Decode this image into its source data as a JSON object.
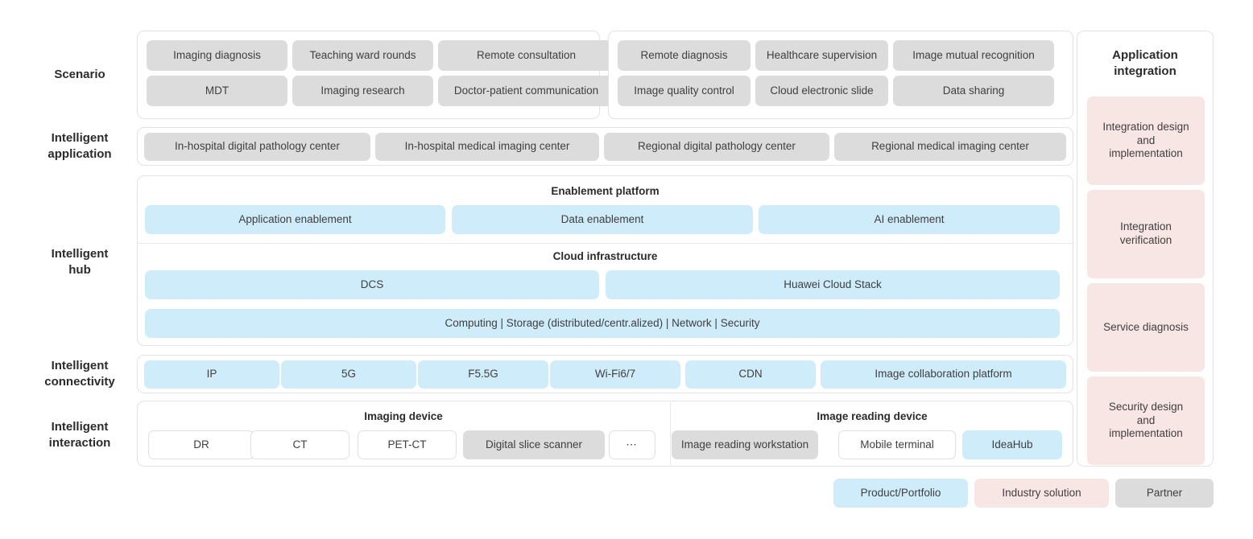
{
  "rows": [
    {
      "label": "Scenario"
    },
    {
      "label": "Intelligent\napplication"
    },
    {
      "label": "Intelligent\nhub"
    },
    {
      "label": "Intelligent\nconnectivity"
    },
    {
      "label": "Intelligent\ninteraction"
    }
  ],
  "scenario": {
    "group_left": [
      "Imaging diagnosis",
      "Teaching ward rounds",
      "Remote consultation",
      "MDT",
      "Imaging research",
      "Doctor-patient communication"
    ],
    "group_right": [
      "Remote diagnosis",
      "Healthcare supervision",
      "Image mutual recognition",
      "Image quality control",
      "Cloud electronic slide",
      "Data sharing"
    ]
  },
  "intelligent_application": {
    "items": [
      "In-hospital digital pathology center",
      "In-hospital medical imaging center",
      "Regional digital pathology center",
      "Regional medical imaging center"
    ]
  },
  "intelligent_hub": {
    "enablement_platform": {
      "title": "Enablement platform",
      "items": [
        "Application enablement",
        "Data enablement",
        "AI enablement"
      ]
    },
    "cloud_infrastructure": {
      "title": "Cloud infrastructure",
      "items": [
        "DCS",
        "Huawei Cloud Stack"
      ],
      "resources": "Computing  |  Storage (distributed/centr.alized)  |  Network  |  Security"
    }
  },
  "intelligent_connectivity": {
    "items": [
      "IP",
      "5G",
      "F5.5G",
      "Wi-Fi6/7",
      "CDN",
      "Image collaboration platform"
    ]
  },
  "intelligent_interaction": {
    "imaging_device": {
      "title": "Imaging device",
      "items": [
        {
          "label": "DR",
          "style": "white"
        },
        {
          "label": "CT",
          "style": "white"
        },
        {
          "label": "PET-CT",
          "style": "white"
        },
        {
          "label": "Digital slice scanner",
          "style": "gray"
        },
        {
          "label": "⋯",
          "style": "white"
        }
      ]
    },
    "image_reading_device": {
      "title": "Image reading device",
      "items": [
        {
          "label": "Image reading workstation",
          "style": "gray"
        },
        {
          "label": "Mobile terminal",
          "style": "white"
        },
        {
          "label": "IdeaHub",
          "style": "blue"
        }
      ]
    }
  },
  "application_integration": {
    "title": "Application\nintegration",
    "items": [
      "Integration design\nand\nimplementation",
      "Integration\nverification",
      "Service diagnosis",
      "Security design\nand\nimplementation"
    ]
  },
  "legend": [
    {
      "label": "Product/Portfolio",
      "style": "blue"
    },
    {
      "label": "Industry solution",
      "style": "pink"
    },
    {
      "label": "Partner",
      "style": "gray"
    }
  ],
  "colors": {
    "blue": "#cfecfa",
    "pink": "#f8e6e4",
    "gray": "#dcdcdc",
    "panel_border": "#e3e3e3",
    "text": "#3f3f3f"
  }
}
